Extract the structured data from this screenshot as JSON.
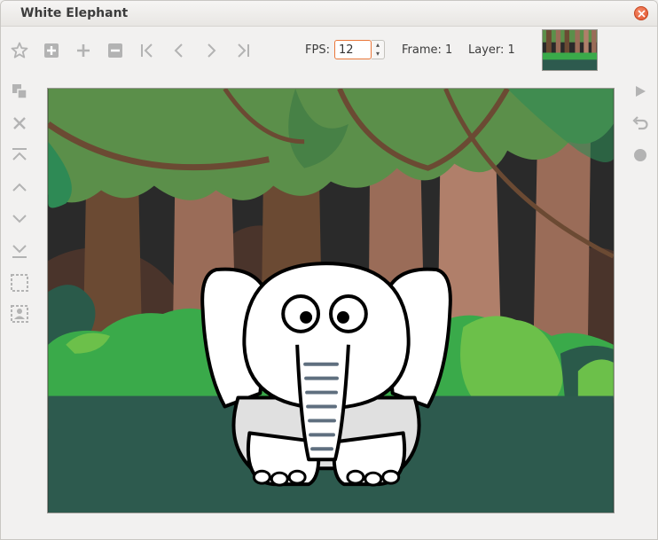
{
  "window": {
    "title": "White Elephant"
  },
  "toolbar": {
    "fps_label": "FPS:",
    "fps_value": "12",
    "frame_text": "Frame: 1",
    "layer_text": "Layer: 1"
  },
  "icons": {
    "top": [
      "star-icon",
      "add-frame-icon",
      "plus-icon",
      "minus-icon",
      "first-frame-icon",
      "previous-frame-icon",
      "next-frame-icon",
      "last-frame-icon"
    ],
    "left": [
      "duplicate-layer-icon",
      "delete-layer-icon",
      "move-to-top-icon",
      "move-up-icon",
      "move-down-icon",
      "move-to-bottom-icon",
      "select-region-icon",
      "layer-image-icon"
    ],
    "right": [
      "play-icon",
      "undo-icon",
      "record-icon"
    ]
  },
  "colors": {
    "accent": "#e9773a",
    "icon_gray": "#b3b3b3",
    "ground": "#2d5a4e",
    "bush": "#3aaa4a",
    "foliage": "#5b8f4a"
  }
}
